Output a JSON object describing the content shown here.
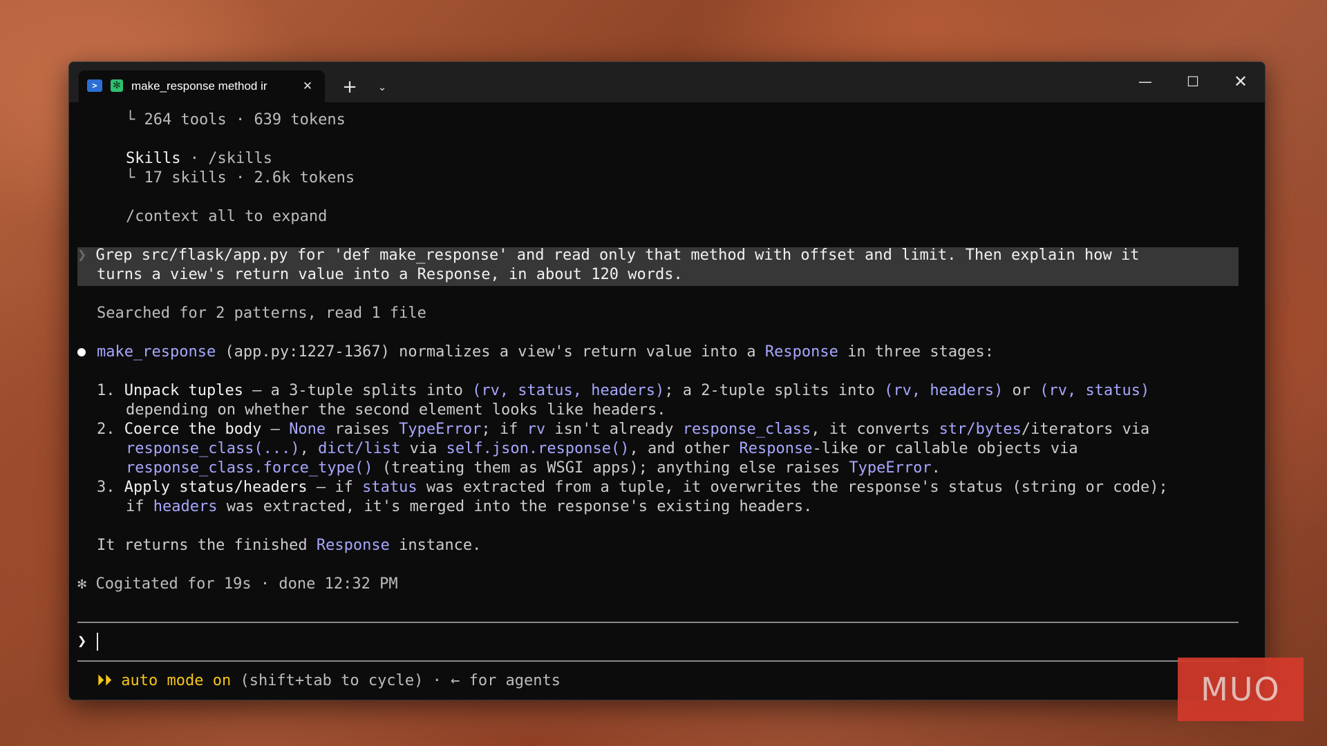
{
  "tab": {
    "title": "make_response method ir",
    "ps_icon": "powershell-icon",
    "claude_icon": "claude-icon",
    "close": "✕"
  },
  "titlebar": {
    "new_tab": "+",
    "dropdown": "⌄",
    "minimize": "—",
    "maximize": "☐",
    "close": "✕"
  },
  "terminal": {
    "tools_branch": "└ ",
    "tools_summary": "264 tools · 639 tokens",
    "skills_label": "Skills",
    "skills_cmd": " · /skills",
    "skills_summary": "17 skills · 2.6k tokens",
    "expand_hint": "/context all to expand",
    "prompt_caret": "❯ ",
    "prompt_line1": "Grep src/flask/app.py for 'def make_response' and read only that method with offset and limit. Then explain how it",
    "prompt_line2": "turns a view's return value into a Response, in about 120 words.",
    "searched": "Searched for 2 patterns, read 1 file",
    "intro": {
      "fn": "make_response",
      "ref": " (app.py:1227-1367) normalizes a view's return value into a ",
      "resp": "Response",
      "tail": " in three stages:"
    },
    "item1": {
      "num": "1. ",
      "bold": "Unpack tuples",
      "t1": " — a 3-tuple splits into ",
      "c1": "(rv, status, headers)",
      "t2": "; a 2-tuple splits into ",
      "c2": "(rv, headers)",
      "t3": " or ",
      "c3": "(rv, status)",
      "line2": "depending on whether the second element looks like headers."
    },
    "item2": {
      "num": "2. ",
      "bold": "Coerce the body",
      "t1": " — ",
      "c1": "None",
      "t2": " raises ",
      "c2": "TypeError",
      "t3": "; if ",
      "c3": "rv",
      "t4": " isn't already ",
      "c4": "response_class",
      "t5": ", it converts ",
      "c5": "str/bytes",
      "t6": "/iterators via",
      "l2c1": "response_class(...)",
      "l2t1": ", ",
      "l2c2": "dict/list",
      "l2t2": " via ",
      "l2c3": "self.json.response()",
      "l2t3": ", and other ",
      "l2c4": "Response",
      "l2t4": "-like or callable objects via",
      "l3c1": "response_class.force_type()",
      "l3t1": " (treating them as WSGI apps); anything else raises ",
      "l3c2": "TypeError",
      "l3t2": "."
    },
    "item3": {
      "num": "3. ",
      "bold": "Apply status/headers",
      "t1": " — if ",
      "c1": "status",
      "t2": " was extracted from a tuple, it overwrites the response's status (string or code);",
      "l2t1": "if ",
      "l2c1": "headers",
      "l2t2": " was extracted, it's merged into the response's existing headers."
    },
    "returns": {
      "t1": "It returns the finished ",
      "c1": "Response",
      "t2": " instance."
    },
    "cogitated": "✻ Cogitated for 19s · done 12:32 PM",
    "input_prompt": "❯",
    "status": {
      "icon": "⏵⏵",
      "mode": " auto mode on",
      "rest": " (shift+tab to cycle) · ← for agents"
    }
  },
  "watermark": "MUO",
  "colors": {
    "terminal_bg": "#0c0c0c",
    "titlebar_bg": "#1f1f1f",
    "prompt_highlight": "#373737",
    "code_accent": "#a7a7ff",
    "status_yellow": "#f5c518",
    "watermark_red": "#d43a2b"
  }
}
